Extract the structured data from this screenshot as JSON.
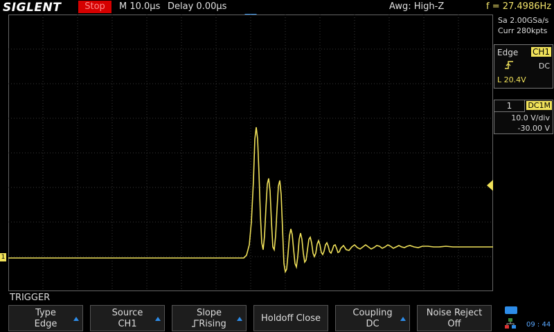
{
  "header": {
    "brand": "SIGLENT",
    "run_state": "Stop",
    "timebase": "M 10.0µs",
    "delay": "Delay 0.00µs",
    "impedance": "Awg: High-Z",
    "frequency": "f = 27.4986Hz"
  },
  "acquisition": {
    "sample_rate": "Sa 2.00GSa/s",
    "memory_depth": "Curr 280kpts"
  },
  "trigger_info": {
    "type": "Edge",
    "source": "CH1",
    "slope_icon": "rising-edge-icon",
    "coupling": "DC",
    "level": "L  20.4V"
  },
  "channel_info": {
    "number": "1",
    "coupling_imp": "DC1M",
    "scale": "10.0 V/div",
    "offset": "-30.00 V"
  },
  "menu": {
    "title": "TRIGGER",
    "softkeys": [
      {
        "line1": "Type",
        "line2": "Edge"
      },
      {
        "line1": "Source",
        "line2": "CH1"
      },
      {
        "line1": "Slope",
        "line2": "Rising"
      },
      {
        "line1": "Holdoff Close",
        "line2": ""
      },
      {
        "line1": "Coupling",
        "line2": "DC"
      },
      {
        "line1": "Noise Reject",
        "line2": "Off"
      }
    ]
  },
  "status_bar": {
    "time": "09 : 44"
  },
  "colors": {
    "channel1": "#f1e25a",
    "grid": "#3a3a3a",
    "accent_blue": "#2d8ce8",
    "stop_red": "#d50000"
  }
}
